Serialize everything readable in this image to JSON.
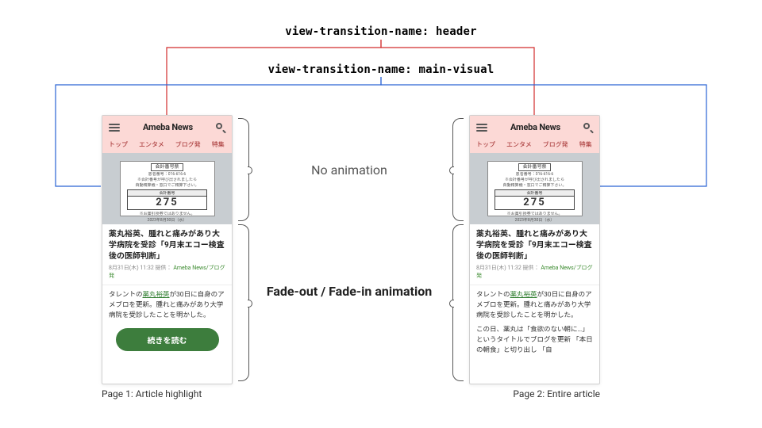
{
  "labels": {
    "header_prop": "view-transition-name: header",
    "main_visual_prop": "view-transition-name: main-visual",
    "no_anim": "No animation",
    "fade_anim": "Fade-out / Fade-in animation",
    "caption_left": "Page 1: Article highlight",
    "caption_right": "Page 2: Entire article"
  },
  "colors": {
    "connector_red": "#d22c2c",
    "connector_blue": "#2a63d4"
  },
  "app": {
    "brand": "Ameba News",
    "tabs": [
      "トップ",
      "エンタメ",
      "ブログ発",
      "特集"
    ]
  },
  "ticket": {
    "header": "会計番号票",
    "line1": "患者番号：016-616-6",
    "line2": "※会計番号が呼び出されましたら",
    "line3": "自動精算機・窓口でご精算下さい。",
    "num_label": "会計番号",
    "number": "275",
    "note": "※お薬引換券ではありません。",
    "date": "2023年8月30日（水）"
  },
  "article": {
    "title": "薬丸裕英、腫れと痛みがあり大学病院を受診「9月末エコー検査後の医師判断」",
    "meta_time": "8月31日(木) 11:32",
    "meta_provider": "提供：",
    "meta_source": "Ameba News/ブログ発",
    "body_p1_pre": "タレントの",
    "body_p1_link": "薬丸裕英",
    "body_p1_post": "が30日に自身のアメブロを更新。腫れと痛みがあり大学病院を受診したことを明かした。",
    "body_p2": "この日、薬丸は「食欲のない朝に…」というタイトルでブログを更新  「本日の朝食」と切り出し 「自",
    "cta": "続きを読む"
  }
}
